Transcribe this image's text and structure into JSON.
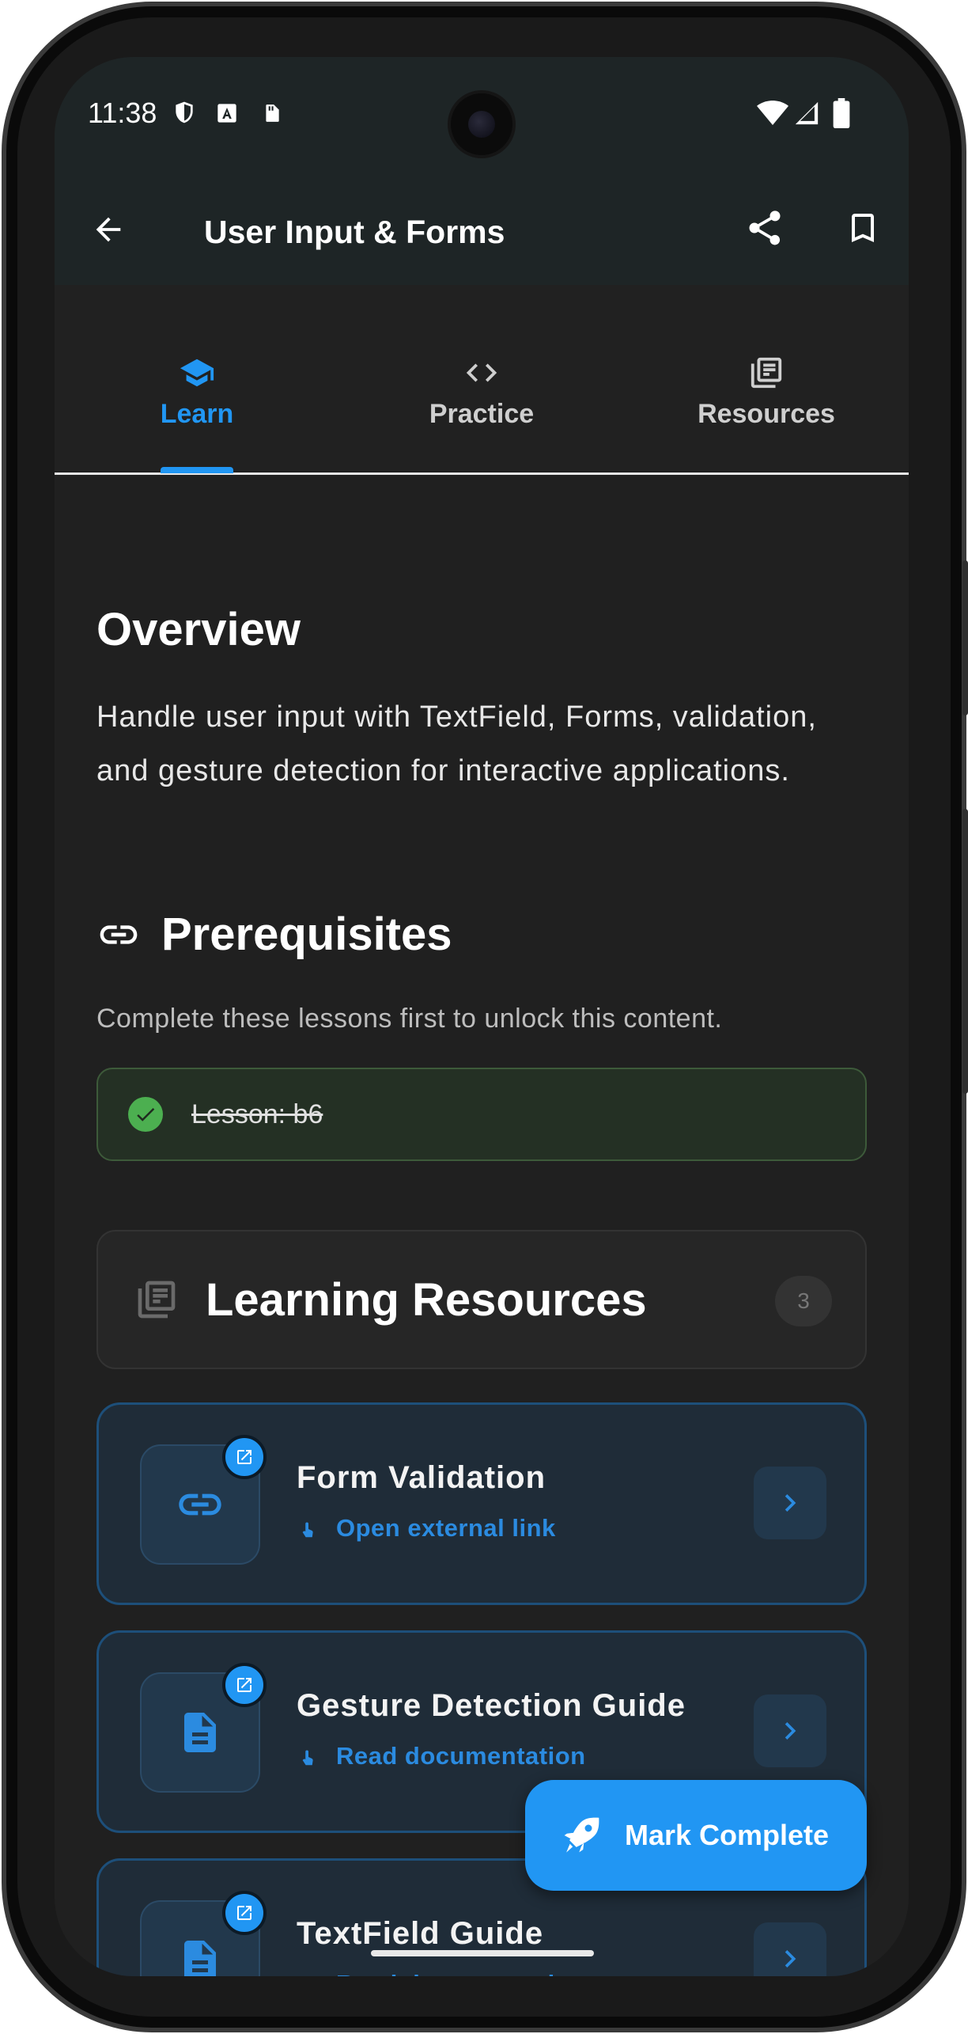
{
  "status_bar": {
    "time": "11:38",
    "icons": [
      "shield-icon",
      "accessibility-icon",
      "sd-card-icon",
      "wifi-icon",
      "signal-icon",
      "battery-icon"
    ]
  },
  "app_bar": {
    "title": "User Input & Forms",
    "icons": [
      "back-arrow-icon",
      "share-icon",
      "bookmark-icon"
    ]
  },
  "tabs": [
    {
      "label": "Learn",
      "icon": "school-icon",
      "selected": true
    },
    {
      "label": "Practice",
      "icon": "code-icon",
      "selected": false
    },
    {
      "label": "Resources",
      "icon": "library-books-icon",
      "selected": false
    }
  ],
  "overview": {
    "title": "Overview",
    "text": "Handle user input with TextField, Forms, validation, and gesture detection for interactive applications."
  },
  "prerequisites": {
    "title": "Prerequisites",
    "subtitle": "Complete these lessons first to unlock this content.",
    "items": [
      {
        "label": "Lesson: b6",
        "completed": true
      }
    ]
  },
  "learning_resources": {
    "title": "Learning Resources",
    "count": "3",
    "items": [
      {
        "title": "Form Validation",
        "subtitle": "Open external link",
        "icon": "link-icon"
      },
      {
        "title": "Gesture Detection Guide",
        "subtitle": "Read documentation",
        "icon": "document-icon"
      },
      {
        "title": "TextField Guide",
        "subtitle": "Read documentation",
        "icon": "document-icon"
      }
    ]
  },
  "fab": {
    "label": "Mark Complete",
    "icon": "rocket-icon"
  },
  "colors": {
    "accent": "#2196f3",
    "background": "#202020",
    "app_bar": "#1e2526",
    "success": "#4caf50"
  }
}
